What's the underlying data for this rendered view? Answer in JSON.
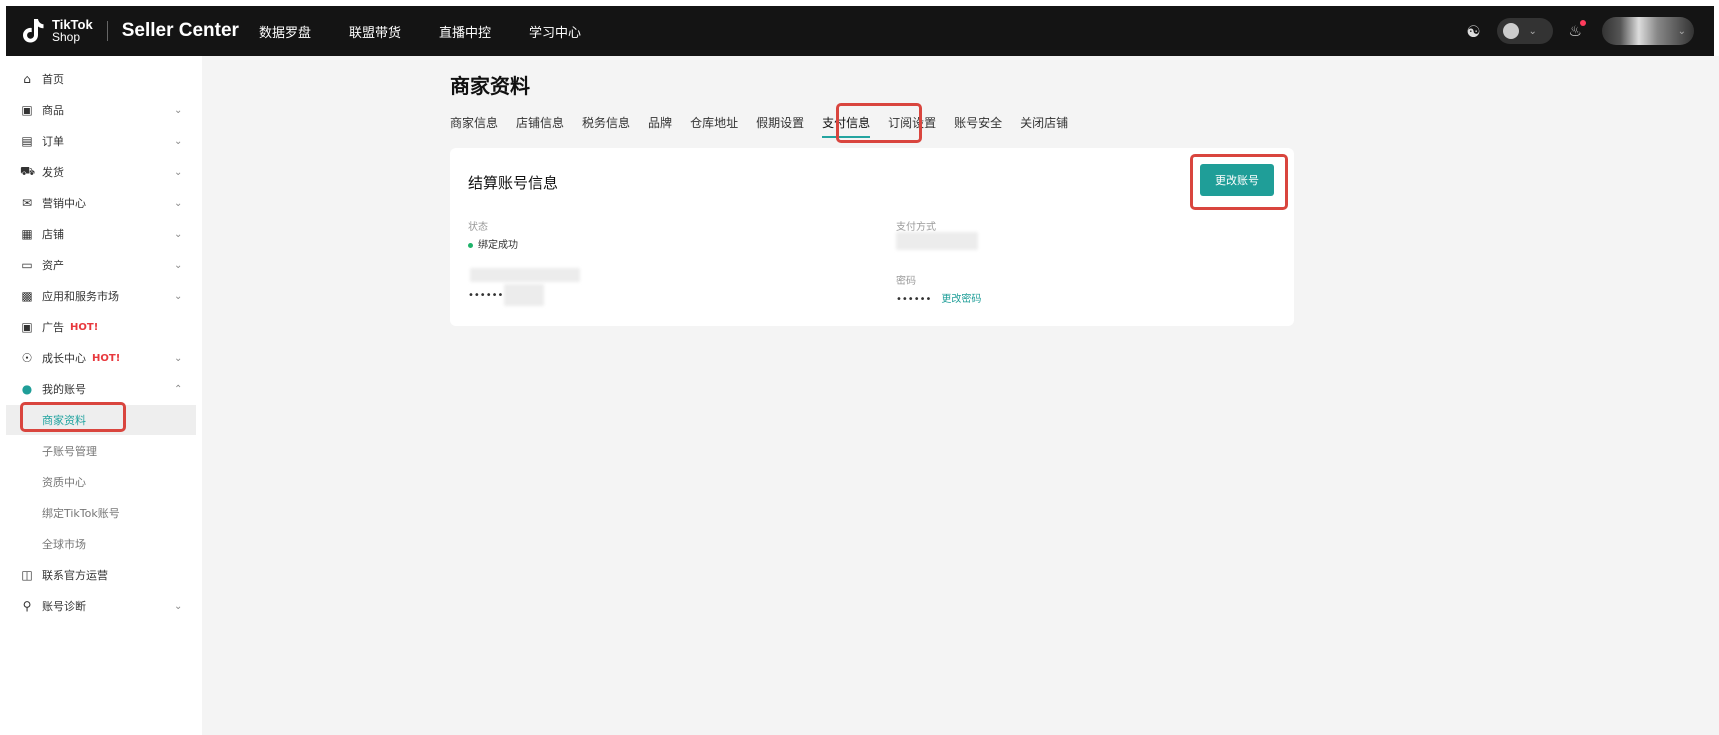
{
  "topbar": {
    "logo_line1": "TikTok",
    "logo_line2": "Shop",
    "brand": "Seller Center",
    "nav": [
      "数据罗盘",
      "联盟带货",
      "直播中控",
      "学习中心"
    ]
  },
  "sidebar": {
    "items": [
      {
        "label": "首页",
        "icon": "home-icon"
      },
      {
        "label": "商品",
        "icon": "product-icon"
      },
      {
        "label": "订单",
        "icon": "order-icon"
      },
      {
        "label": "发货",
        "icon": "shipping-icon"
      },
      {
        "label": "营销中心",
        "icon": "megaphone-icon"
      },
      {
        "label": "店铺",
        "icon": "store-icon"
      },
      {
        "label": "资产",
        "icon": "wallet-icon"
      },
      {
        "label": "应用和服务市场",
        "icon": "apps-icon"
      },
      {
        "label": "广告",
        "icon": "ad-icon",
        "badge": "HOT!"
      },
      {
        "label": "成长中心",
        "icon": "medal-icon",
        "badge": "HOT!"
      },
      {
        "label": "我的账号",
        "icon": "user-icon"
      }
    ],
    "subitems": [
      "商家资料",
      "子账号管理",
      "资质中心",
      "绑定TikTok账号",
      "全球市场"
    ],
    "bottom_items": [
      {
        "label": "联系官方运营",
        "icon": "contact-icon"
      },
      {
        "label": "账号诊断",
        "icon": "diagnose-icon"
      }
    ]
  },
  "main": {
    "title": "商家资料",
    "tabs": [
      "商家信息",
      "店铺信息",
      "税务信息",
      "品牌",
      "仓库地址",
      "假期设置",
      "支付信息",
      "订阅设置",
      "账号安全",
      "关闭店铺"
    ],
    "active_tab": "支付信息",
    "card": {
      "title": "结算账号信息",
      "button": "更改账号",
      "status_label": "状态",
      "status_value": "绑定成功",
      "payment_method_label": "支付方式",
      "account_masked": "••••••",
      "password_label": "密码",
      "password_masked": "••••••",
      "password_link": "更改密码"
    }
  },
  "colors": {
    "topbar_bg": "#141414",
    "accent": "#1f9e98",
    "highlight_box": "#d9453e",
    "hot": "#e8383d"
  }
}
